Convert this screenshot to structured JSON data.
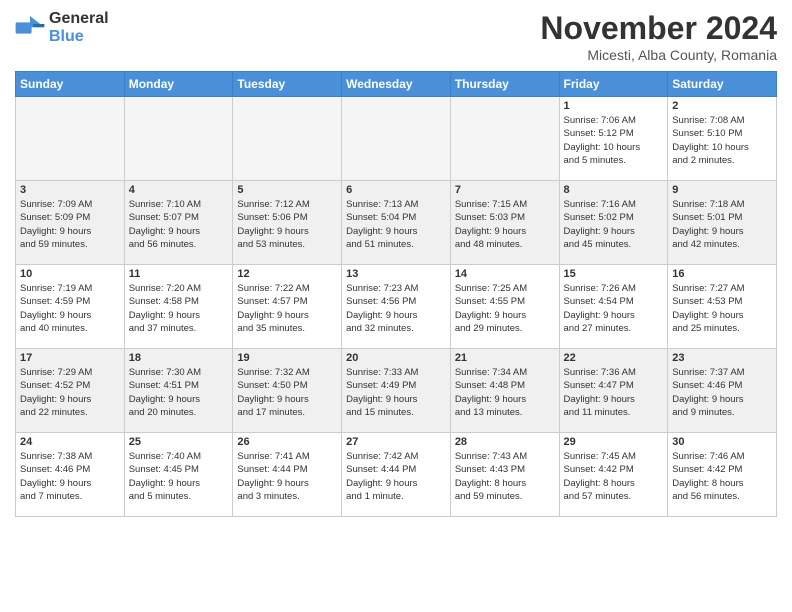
{
  "header": {
    "logo_general": "General",
    "logo_blue": "Blue",
    "month_title": "November 2024",
    "location": "Micesti, Alba County, Romania"
  },
  "weekdays": [
    "Sunday",
    "Monday",
    "Tuesday",
    "Wednesday",
    "Thursday",
    "Friday",
    "Saturday"
  ],
  "weeks": [
    [
      {
        "day": "",
        "info": ""
      },
      {
        "day": "",
        "info": ""
      },
      {
        "day": "",
        "info": ""
      },
      {
        "day": "",
        "info": ""
      },
      {
        "day": "",
        "info": ""
      },
      {
        "day": "1",
        "info": "Sunrise: 7:06 AM\nSunset: 5:12 PM\nDaylight: 10 hours\nand 5 minutes."
      },
      {
        "day": "2",
        "info": "Sunrise: 7:08 AM\nSunset: 5:10 PM\nDaylight: 10 hours\nand 2 minutes."
      }
    ],
    [
      {
        "day": "3",
        "info": "Sunrise: 7:09 AM\nSunset: 5:09 PM\nDaylight: 9 hours\nand 59 minutes."
      },
      {
        "day": "4",
        "info": "Sunrise: 7:10 AM\nSunset: 5:07 PM\nDaylight: 9 hours\nand 56 minutes."
      },
      {
        "day": "5",
        "info": "Sunrise: 7:12 AM\nSunset: 5:06 PM\nDaylight: 9 hours\nand 53 minutes."
      },
      {
        "day": "6",
        "info": "Sunrise: 7:13 AM\nSunset: 5:04 PM\nDaylight: 9 hours\nand 51 minutes."
      },
      {
        "day": "7",
        "info": "Sunrise: 7:15 AM\nSunset: 5:03 PM\nDaylight: 9 hours\nand 48 minutes."
      },
      {
        "day": "8",
        "info": "Sunrise: 7:16 AM\nSunset: 5:02 PM\nDaylight: 9 hours\nand 45 minutes."
      },
      {
        "day": "9",
        "info": "Sunrise: 7:18 AM\nSunset: 5:01 PM\nDaylight: 9 hours\nand 42 minutes."
      }
    ],
    [
      {
        "day": "10",
        "info": "Sunrise: 7:19 AM\nSunset: 4:59 PM\nDaylight: 9 hours\nand 40 minutes."
      },
      {
        "day": "11",
        "info": "Sunrise: 7:20 AM\nSunset: 4:58 PM\nDaylight: 9 hours\nand 37 minutes."
      },
      {
        "day": "12",
        "info": "Sunrise: 7:22 AM\nSunset: 4:57 PM\nDaylight: 9 hours\nand 35 minutes."
      },
      {
        "day": "13",
        "info": "Sunrise: 7:23 AM\nSunset: 4:56 PM\nDaylight: 9 hours\nand 32 minutes."
      },
      {
        "day": "14",
        "info": "Sunrise: 7:25 AM\nSunset: 4:55 PM\nDaylight: 9 hours\nand 29 minutes."
      },
      {
        "day": "15",
        "info": "Sunrise: 7:26 AM\nSunset: 4:54 PM\nDaylight: 9 hours\nand 27 minutes."
      },
      {
        "day": "16",
        "info": "Sunrise: 7:27 AM\nSunset: 4:53 PM\nDaylight: 9 hours\nand 25 minutes."
      }
    ],
    [
      {
        "day": "17",
        "info": "Sunrise: 7:29 AM\nSunset: 4:52 PM\nDaylight: 9 hours\nand 22 minutes."
      },
      {
        "day": "18",
        "info": "Sunrise: 7:30 AM\nSunset: 4:51 PM\nDaylight: 9 hours\nand 20 minutes."
      },
      {
        "day": "19",
        "info": "Sunrise: 7:32 AM\nSunset: 4:50 PM\nDaylight: 9 hours\nand 17 minutes."
      },
      {
        "day": "20",
        "info": "Sunrise: 7:33 AM\nSunset: 4:49 PM\nDaylight: 9 hours\nand 15 minutes."
      },
      {
        "day": "21",
        "info": "Sunrise: 7:34 AM\nSunset: 4:48 PM\nDaylight: 9 hours\nand 13 minutes."
      },
      {
        "day": "22",
        "info": "Sunrise: 7:36 AM\nSunset: 4:47 PM\nDaylight: 9 hours\nand 11 minutes."
      },
      {
        "day": "23",
        "info": "Sunrise: 7:37 AM\nSunset: 4:46 PM\nDaylight: 9 hours\nand 9 minutes."
      }
    ],
    [
      {
        "day": "24",
        "info": "Sunrise: 7:38 AM\nSunset: 4:46 PM\nDaylight: 9 hours\nand 7 minutes."
      },
      {
        "day": "25",
        "info": "Sunrise: 7:40 AM\nSunset: 4:45 PM\nDaylight: 9 hours\nand 5 minutes."
      },
      {
        "day": "26",
        "info": "Sunrise: 7:41 AM\nSunset: 4:44 PM\nDaylight: 9 hours\nand 3 minutes."
      },
      {
        "day": "27",
        "info": "Sunrise: 7:42 AM\nSunset: 4:44 PM\nDaylight: 9 hours\nand 1 minute."
      },
      {
        "day": "28",
        "info": "Sunrise: 7:43 AM\nSunset: 4:43 PM\nDaylight: 8 hours\nand 59 minutes."
      },
      {
        "day": "29",
        "info": "Sunrise: 7:45 AM\nSunset: 4:42 PM\nDaylight: 8 hours\nand 57 minutes."
      },
      {
        "day": "30",
        "info": "Sunrise: 7:46 AM\nSunset: 4:42 PM\nDaylight: 8 hours\nand 56 minutes."
      }
    ]
  ]
}
